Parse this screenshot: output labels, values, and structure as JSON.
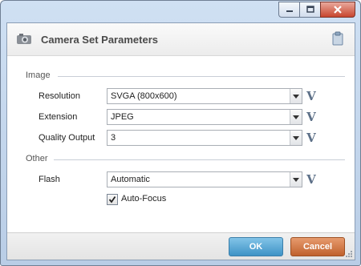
{
  "window": {
    "title": "Camera Set Parameters",
    "controls": [
      "minimize",
      "maximize",
      "close"
    ]
  },
  "sections": {
    "image": "Image",
    "other": "Other"
  },
  "fields": {
    "resolution": {
      "label": "Resolution",
      "value": "SVGA (800x600)"
    },
    "extension": {
      "label": "Extension",
      "value": "JPEG"
    },
    "quality": {
      "label": "Quality Output",
      "value": "3"
    },
    "flash": {
      "label": "Flash",
      "value": "Automatic"
    }
  },
  "autofocus": {
    "label": "Auto-Focus",
    "checked": true
  },
  "variable_button_glyph": "V",
  "buttons": {
    "ok": "OK",
    "cancel": "Cancel"
  },
  "colors": {
    "ok": "#3e93c6",
    "cancel": "#c0612c",
    "close": "#c8462f"
  }
}
